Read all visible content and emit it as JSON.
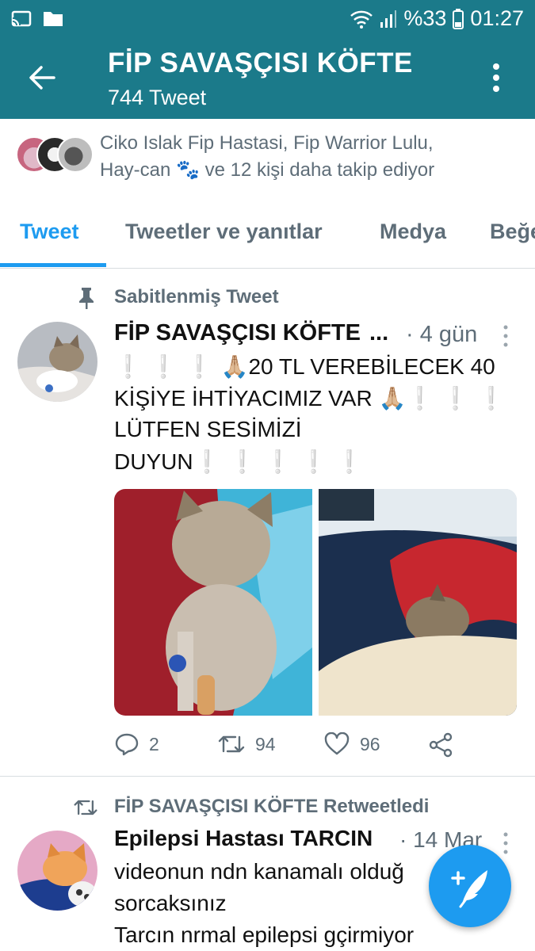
{
  "status_bar": {
    "battery": "%33",
    "time": "01:27",
    "icons": [
      "cast-icon",
      "folder-icon",
      "wifi-icon",
      "signal-icon",
      "battery-icon"
    ]
  },
  "header": {
    "title": "FİP SAVAŞÇISI KÖFTE",
    "subtitle": "744 Tweet",
    "back_icon": "arrow-left-icon",
    "more_icon": "vertical-dots-icon"
  },
  "followers": {
    "line1": "Ciko Islak Fip Hastasi, Fip Warrior Lulu,",
    "line2": "Hay-can 🐾 ve 12 kişi daha takip ediyor"
  },
  "tabs": [
    {
      "label": "Tweet",
      "active": true
    },
    {
      "label": "Tweetler ve yanıtlar",
      "active": false
    },
    {
      "label": "Medya",
      "active": false
    },
    {
      "label": "Beğe",
      "active": false
    }
  ],
  "pinned_tweet": {
    "pin_label": "Sabitlenmiş Tweet",
    "author": "FİP SAVAŞÇISI KÖFTE",
    "ellipsis": "...",
    "time": "· 4 gün",
    "text": {
      "line1_marks": "❕❕❕",
      "line1": "🙏🏼20 TL VEREBİLECEK 40",
      "line2": "KİŞİYE İHTİYACIMIZ VAR 🙏🏼",
      "line2_marks": "❕❕❕",
      "line3": "LÜTFEN SESİMİZİ",
      "line4": "DUYUN",
      "line4_marks": "❕❕❕❕❕"
    },
    "stats": {
      "replies": "2",
      "retweets": "94",
      "likes": "96"
    }
  },
  "retweet": {
    "label": "FİP SAVAŞÇISI KÖFTE Retweetledi",
    "author": "Epilepsi Hastası TARCIN",
    "time": "· 14 Mar",
    "line1": "videonun ndn kanamalı olduğ",
    "line2": "sorcaksınız",
    "line3": "Tarcın nrmal epilepsi gçirmiyor"
  },
  "fab": {
    "icon": "compose-feather-icon"
  },
  "colors": {
    "header": "#1b7a8a",
    "accent": "#1d9bf0",
    "muted": "#5e6d78"
  }
}
